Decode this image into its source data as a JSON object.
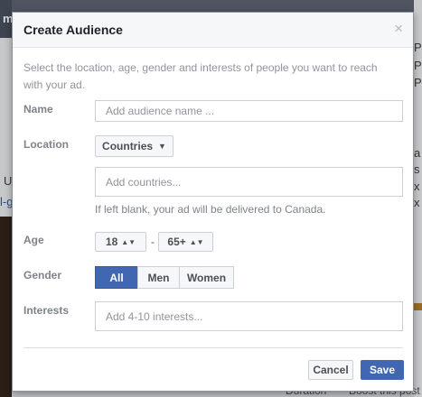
{
  "background": {
    "top_text": "m",
    "left_u": "U",
    "left_link": "l-g",
    "right_chars": [
      "P",
      "P",
      "P",
      "a",
      "s",
      "x",
      "x"
    ],
    "footer_left": "Duration",
    "footer_right": "Boost this post"
  },
  "dialog": {
    "title": "Create Audience",
    "close_glyph": "×",
    "intro": "Select the location, age, gender and interests of people you want to reach with your ad.",
    "name": {
      "label": "Name",
      "placeholder": "Add audience name ..."
    },
    "location": {
      "label": "Location",
      "dropdown_label": "Countries",
      "dropdown_icon": "caret-down-icon",
      "countries_placeholder": "Add countries...",
      "hint": "If left blank, your ad will be delivered to Canada."
    },
    "age": {
      "label": "Age",
      "min": "18",
      "max": "65+",
      "separator": "-"
    },
    "gender": {
      "label": "Gender",
      "options": [
        "All",
        "Men",
        "Women"
      ],
      "selected": "All"
    },
    "interests": {
      "label": "Interests",
      "placeholder": "Add 4-10 interests..."
    },
    "buttons": {
      "cancel": "Cancel",
      "save": "Save"
    }
  },
  "colors": {
    "primary": "#4267b2",
    "overlay": "#7a7a7a"
  }
}
